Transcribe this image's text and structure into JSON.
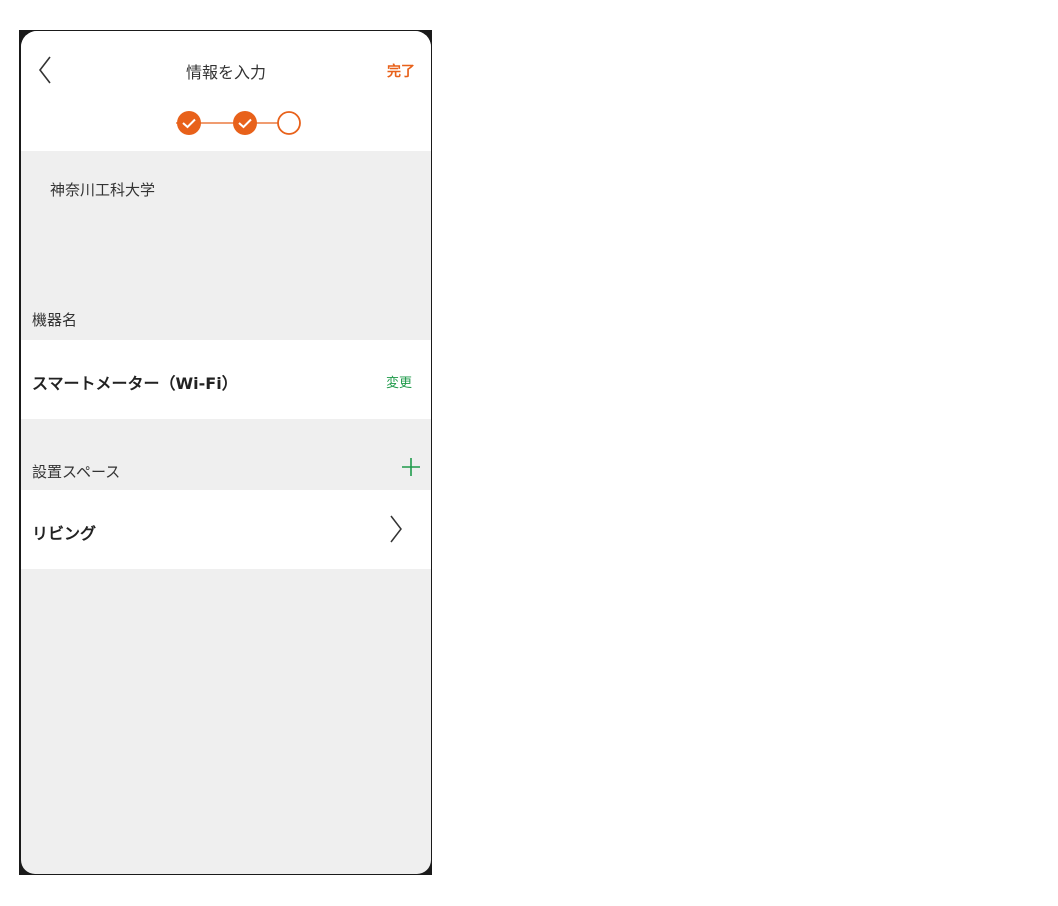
{
  "header": {
    "title": "情報を入力",
    "done_label": "完了"
  },
  "stepper": {
    "total_steps": 3,
    "completed_steps": 2,
    "accent_color": "#e8611a"
  },
  "location": {
    "name": "神奈川工科大学"
  },
  "device": {
    "section_label": "機器名",
    "name": "スマートメーター（Wi-Fi）",
    "change_label": "変更"
  },
  "space": {
    "section_label": "設置スペース",
    "value": "リビング"
  },
  "colors": {
    "accent_orange": "#e8611a",
    "accent_green": "#1e9a4a",
    "background": "#efefef"
  }
}
